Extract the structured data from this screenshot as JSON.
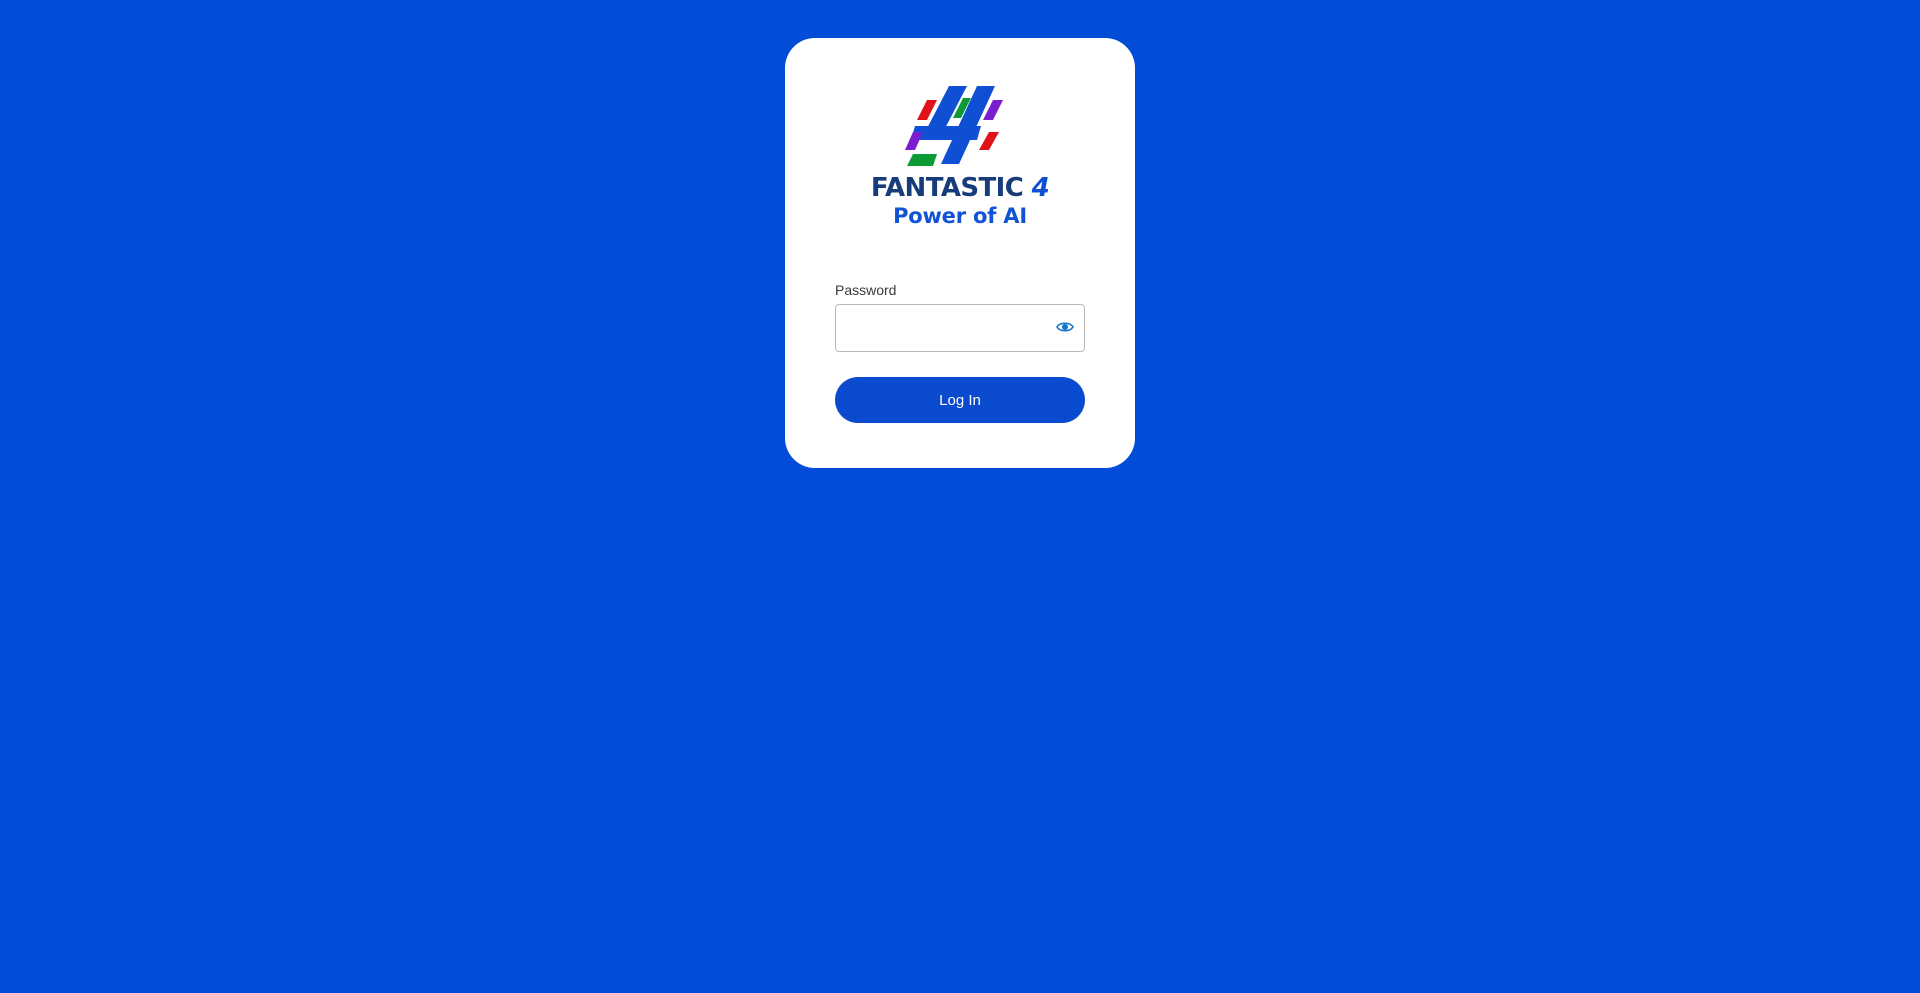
{
  "brand": {
    "logo_icon": "fantastic-4-logo-icon",
    "name": "FANTASTIC",
    "name_number": "4",
    "tagline": "Power of AI"
  },
  "form": {
    "password_label": "Password",
    "password_value": "",
    "show_password_icon": "eye-icon",
    "submit_label": "Log In"
  },
  "colors": {
    "background": "#024cd7",
    "card": "#ffffff",
    "primary_button": "#0a4acf",
    "brand_dark": "#173c7a",
    "brand_blue": "#1153d6",
    "logo_red": "#e0121c",
    "logo_green": "#0b9a34",
    "logo_purple": "#7a1fd0",
    "eye_icon": "#1176c9"
  }
}
